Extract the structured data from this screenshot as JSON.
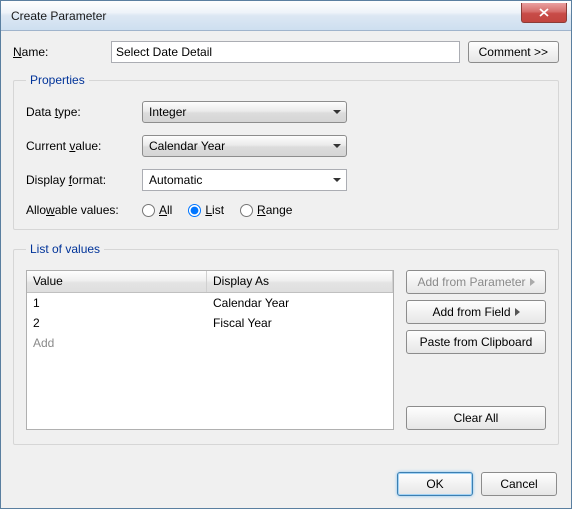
{
  "window": {
    "title": "Create Parameter"
  },
  "name": {
    "label": "Name:",
    "underline": "N",
    "value": "Select Date Detail"
  },
  "comment_btn": "Comment >>",
  "properties": {
    "legend": "Properties",
    "data_type": {
      "label": "Data type:",
      "underline": "t",
      "value": "Integer"
    },
    "current_value": {
      "label": "Current value:",
      "underline": "v",
      "value": "Calendar Year"
    },
    "display_format": {
      "label": "Display format:",
      "underline": "f",
      "value": "Automatic"
    },
    "allowable_values": {
      "label": "Allowable values:",
      "underline": "w",
      "options": {
        "all": "All",
        "list": "List",
        "range": "Range"
      },
      "underlines": {
        "all": "A",
        "list": "L",
        "range": "R"
      },
      "selected": "list"
    }
  },
  "list_of_values": {
    "legend": "List of values",
    "headers": {
      "value": "Value",
      "display_as": "Display As"
    },
    "rows": [
      {
        "value": "1",
        "display": "Calendar Year"
      },
      {
        "value": "2",
        "display": "Fiscal Year"
      }
    ],
    "add_placeholder": "Add",
    "buttons": {
      "add_from_parameter": "Add from Parameter",
      "add_from_field": "Add from Field",
      "paste_from_clipboard": "Paste from Clipboard",
      "clear_all": "Clear All"
    }
  },
  "dialog": {
    "ok": "OK",
    "cancel": "Cancel"
  }
}
